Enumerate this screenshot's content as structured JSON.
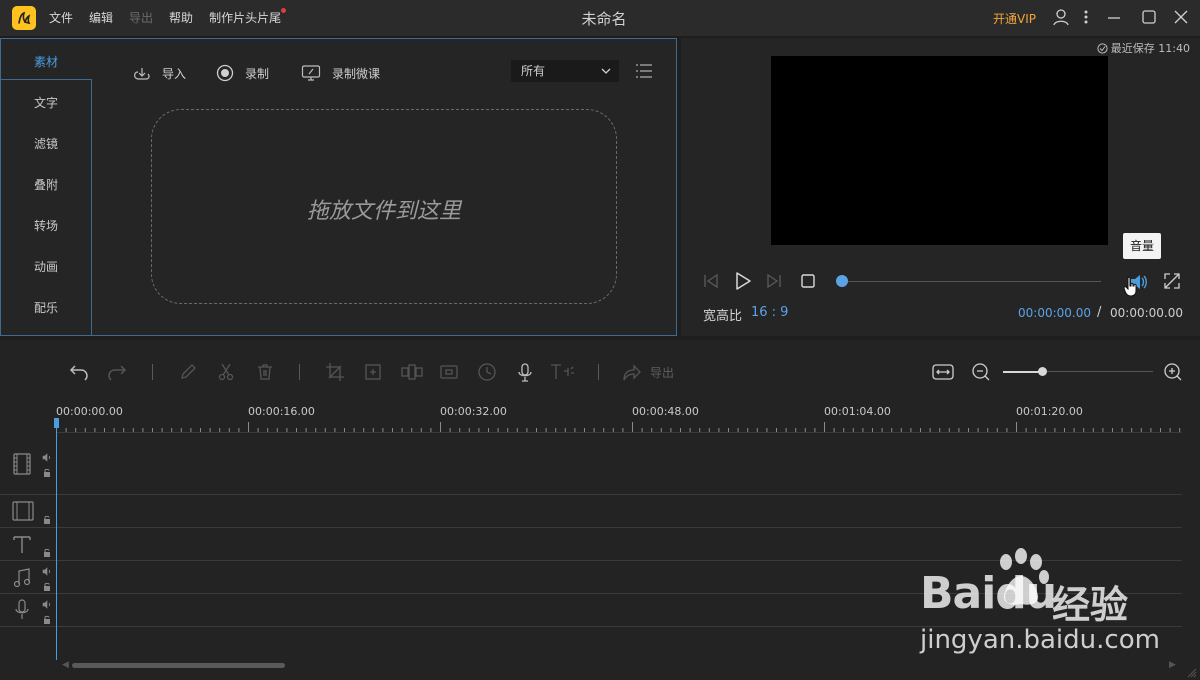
{
  "titlebar": {
    "app_title": "未命名",
    "menu": [
      {
        "label": "文件"
      },
      {
        "label": "编辑"
      },
      {
        "label": "导出"
      },
      {
        "label": "帮助"
      },
      {
        "label": "制作片头片尾"
      }
    ],
    "vip_label": "开通VIP",
    "icons": [
      "user-icon",
      "more-icon",
      "minimize-icon",
      "maximize-icon",
      "close-icon"
    ],
    "accent_color": "#f3a53a"
  },
  "media_panel": {
    "sidebar_tabs": [
      {
        "label": "素材",
        "active": true
      },
      {
        "label": "文字"
      },
      {
        "label": "滤镜"
      },
      {
        "label": "叠附"
      },
      {
        "label": "转场"
      },
      {
        "label": "动画"
      },
      {
        "label": "配乐"
      }
    ],
    "actions": [
      {
        "label": "导入",
        "icon": "import-icon"
      },
      {
        "label": "录制",
        "icon": "record-icon"
      },
      {
        "label": "录制微课",
        "icon": "screen-record-icon"
      }
    ],
    "filter": {
      "selected": "所有"
    },
    "drop_zone_text": "拖放文件到这里",
    "active_color": "#4a9ee0"
  },
  "preview_panel": {
    "last_saved": "最近保存 11:40",
    "tooltip": "音量",
    "aspect_ratio_label": "宽高比",
    "aspect_ratio_value": "16 : 9",
    "time_current": "00:00:00.00",
    "time_separator": "/",
    "time_total": "00:00:00.00",
    "progress": 0
  },
  "timeline": {
    "toolbar": [
      "undo-icon",
      "redo-icon",
      "edit-icon",
      "cut-icon",
      "delete-icon",
      "crop-icon",
      "resize-icon",
      "mosaic-icon",
      "freeze-frame-icon",
      "speed-icon",
      "voiceover-icon",
      "text-to-speech-icon",
      "export-icon"
    ],
    "export_label": "导出",
    "ruler_labels": [
      "00:00:00.00",
      "00:00:16.00",
      "00:00:32.00",
      "00:00:48.00",
      "00:01:04.00",
      "00:01:20.00"
    ],
    "tracks": [
      "video-track-icon",
      "overlay-track-icon",
      "text-track-icon",
      "music-track-icon",
      "voice-track-icon"
    ]
  },
  "watermark": {
    "brand": "Baidu",
    "brand_cn": "经验",
    "url": "jingyan.baidu.com"
  }
}
